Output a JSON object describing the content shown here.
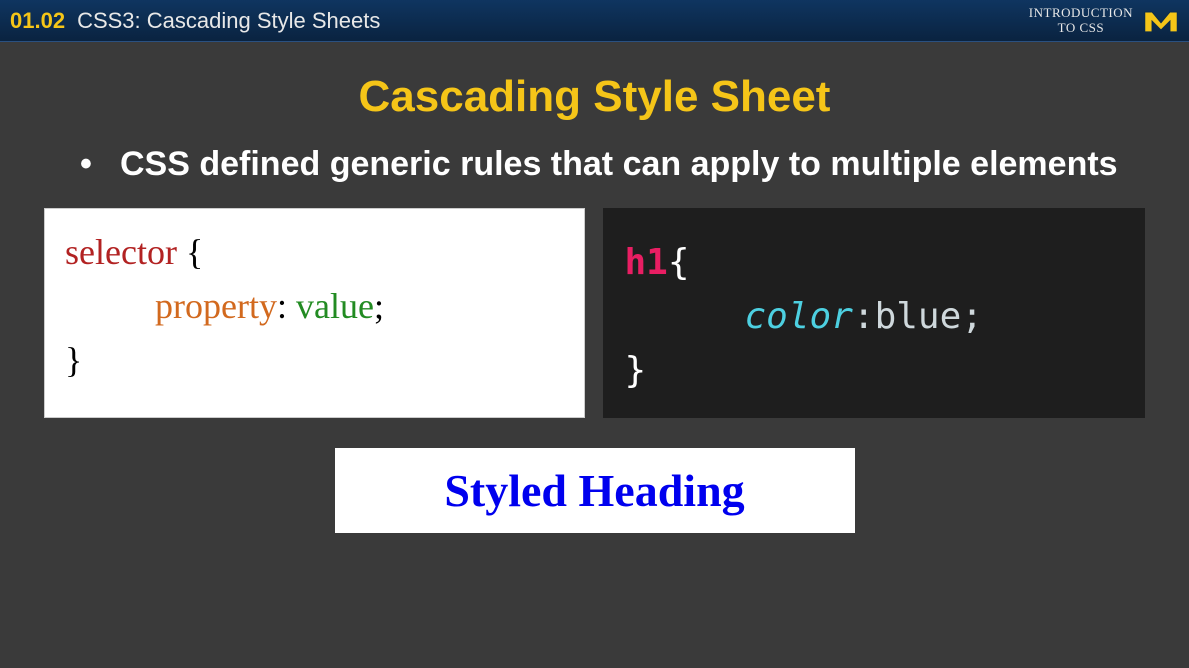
{
  "header": {
    "slide_number": "01.02",
    "subject": "CSS3: Cascading Style Sheets",
    "course_line1": "INTRODUCTION",
    "course_line2": "TO CSS"
  },
  "title": "Cascading Style Sheet",
  "bullet": "CSS defined generic rules that can apply to multiple elements",
  "syntax_box": {
    "selector": "selector",
    "open_brace": "{",
    "property": "property",
    "colon": ":",
    "value": "value",
    "semicolon": ";",
    "close_brace": "}"
  },
  "example_box": {
    "selector": "h1",
    "open_brace": "{",
    "property": "color",
    "colon": ":",
    "value": "blue",
    "semicolon": ";",
    "close_brace": "}"
  },
  "result": "Styled Heading"
}
